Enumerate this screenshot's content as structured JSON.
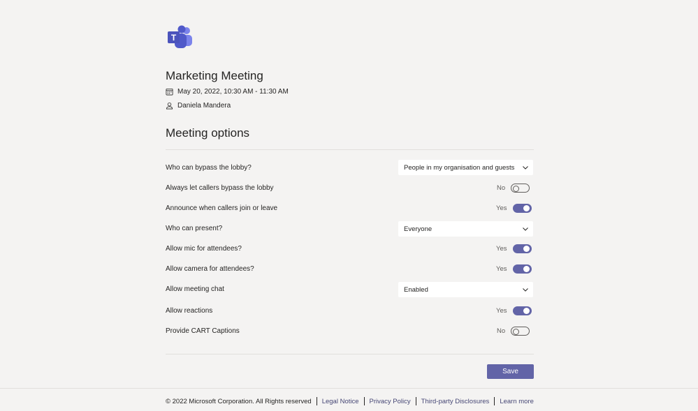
{
  "meeting": {
    "title": "Marketing Meeting",
    "datetime": "May 20, 2022, 10:30 AM - 11:30 AM",
    "organizer": "Daniela Mandera"
  },
  "section_title": "Meeting options",
  "options": {
    "bypass_lobby": {
      "label": "Who can bypass the lobby?",
      "value": "People in my organisation and guests"
    },
    "callers_bypass": {
      "label": "Always let callers bypass the lobby",
      "state": "No"
    },
    "announce_callers": {
      "label": "Announce when callers join or leave",
      "state": "Yes"
    },
    "who_present": {
      "label": "Who can present?",
      "value": "Everyone"
    },
    "allow_mic": {
      "label": "Allow mic for attendees?",
      "state": "Yes"
    },
    "allow_camera": {
      "label": "Allow camera for attendees?",
      "state": "Yes"
    },
    "meeting_chat": {
      "label": "Allow meeting chat",
      "value": "Enabled"
    },
    "allow_reactions": {
      "label": "Allow reactions",
      "state": "Yes"
    },
    "cart_captions": {
      "label": "Provide CART Captions",
      "state": "No"
    }
  },
  "save_label": "Save",
  "footer": {
    "copyright": "© 2022 Microsoft Corporation. All Rights reserved",
    "legal": "Legal Notice",
    "privacy": "Privacy Policy",
    "third_party": "Third-party Disclosures",
    "learn_more": "Learn more"
  },
  "colors": {
    "accent": "#6264a7",
    "background": "#f4f3f2"
  },
  "icons": {
    "app_logo": "teams-logo-icon",
    "calendar": "calendar-icon",
    "person": "person-icon",
    "dropdown": "chevron-down-icon"
  }
}
